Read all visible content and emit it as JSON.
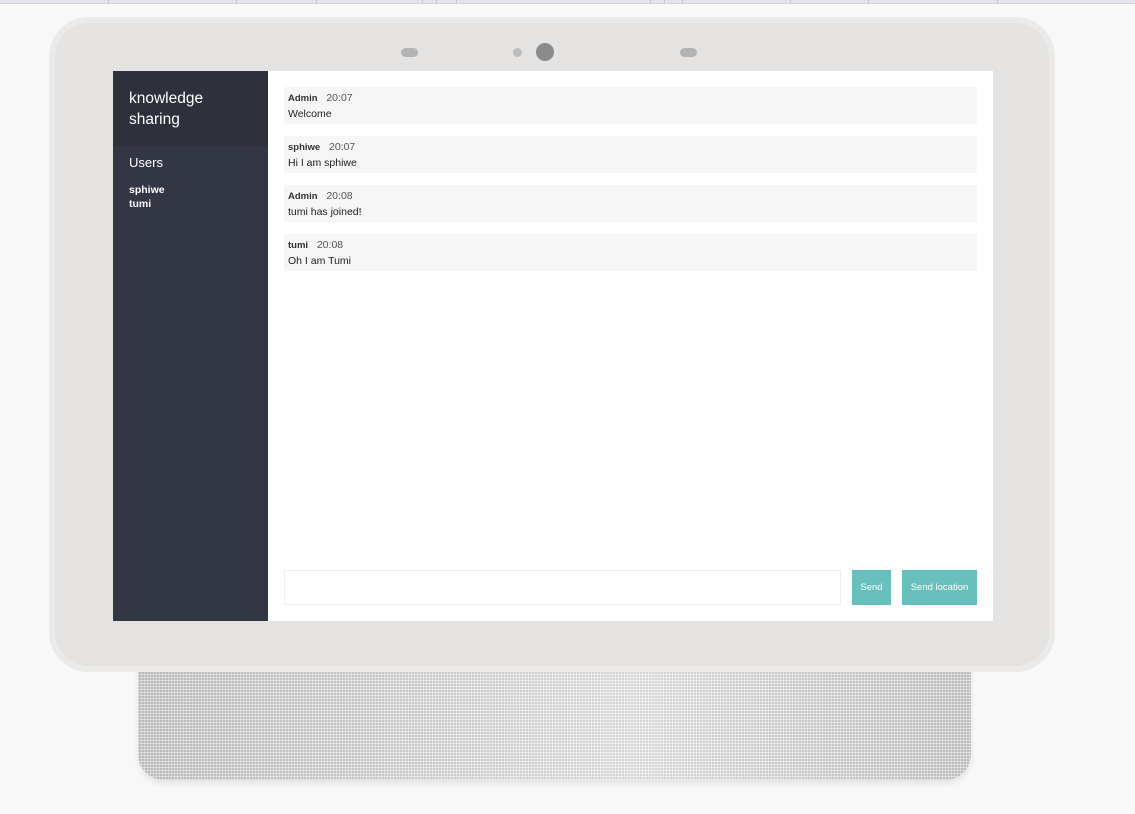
{
  "app": {
    "title": "knowledge sharing"
  },
  "sidebar": {
    "users_heading": "Users",
    "users": [
      "sphiwe",
      "tumi"
    ]
  },
  "messages": [
    {
      "username": "Admin",
      "time": "20:07",
      "text": "Welcome"
    },
    {
      "username": "sphiwe",
      "time": "20:07",
      "text": "Hi I am sphiwe"
    },
    {
      "username": "Admin",
      "time": "20:08",
      "text": "tumi has joined!"
    },
    {
      "username": "tumi",
      "time": "20:08",
      "text": "Oh I am Tumi"
    }
  ],
  "compose": {
    "placeholder": "",
    "value": "",
    "send_label": "Send",
    "send_location_label": "Send location"
  },
  "colors": {
    "sidebar_bg": "#333744",
    "sidebar_title_bg": "#2e313b",
    "button_accent": "#67c0bb",
    "message_bg": "#f6f6f7"
  }
}
